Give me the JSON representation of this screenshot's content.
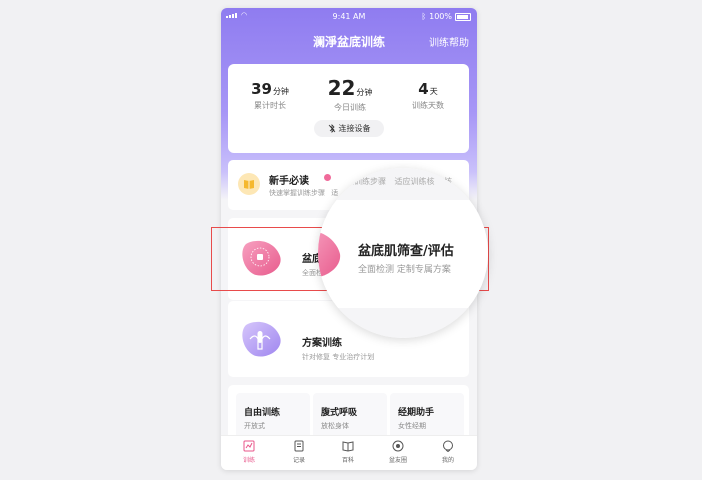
{
  "status": {
    "time": "9:41 AM",
    "battery": "100%"
  },
  "nav": {
    "title": "澜淨盆底训练",
    "help": "训练帮助"
  },
  "stats": [
    {
      "value": "39",
      "unit": "分钟",
      "label": "累计时长"
    },
    {
      "value": "22",
      "unit": "分钟",
      "label": "今日训练"
    },
    {
      "value": "4",
      "unit": "天",
      "label": "训练天数"
    }
  ],
  "connect": {
    "label": "连接设备",
    "icon": "bluetooth-off-icon"
  },
  "guide": {
    "title": "新手必读",
    "subtitle": "快速掌握训练步骤",
    "subtitle_tail": "适",
    "tag1": "握训练步骤",
    "tag2": "适应训练核",
    "icon": "book-icon"
  },
  "assessment": {
    "title": "盆底肌筛查/评估",
    "title_partial": "盆底",
    "desc": "全面检测 定制专属方案",
    "desc_partial": "全面检"
  },
  "plan": {
    "title": "方案训练",
    "desc": "针对修复 专业治疗计划"
  },
  "mini_cards": [
    {
      "title": "自由训练",
      "sub": "开放式"
    },
    {
      "title": "腹式呼吸",
      "sub": "放松身体"
    },
    {
      "title": "经期助手",
      "sub": "女性经期"
    }
  ],
  "tabs": [
    {
      "label": "训练",
      "icon": "chart-icon",
      "active": true
    },
    {
      "label": "记录",
      "icon": "document-icon",
      "active": false
    },
    {
      "label": "百科",
      "icon": "open-book-icon",
      "active": false
    },
    {
      "label": "盆友圈",
      "icon": "compass-icon",
      "active": false
    },
    {
      "label": "我的",
      "icon": "chat-bubble-icon",
      "active": false
    }
  ],
  "colors": {
    "primary": "#8f7cf0",
    "accent": "#e8568a",
    "highlight": "#e84b4b"
  }
}
